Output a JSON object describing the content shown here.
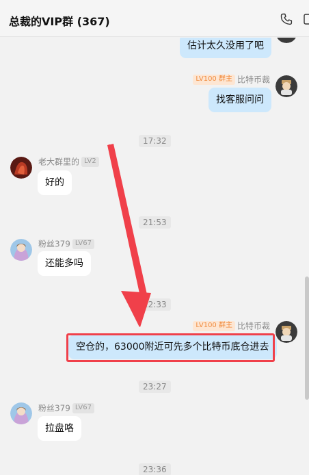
{
  "header": {
    "title": "总裁的VIP群 (367)",
    "icons": [
      "phone-icon",
      "window-icon"
    ]
  },
  "messages": [
    {
      "type": "out",
      "text": "估计太久没用了吧"
    },
    {
      "type": "out",
      "sender": "比特币裁",
      "badge": "LV100 群主",
      "text": "找客服问问"
    },
    {
      "type": "time",
      "text": "17:32"
    },
    {
      "type": "in",
      "sender": "老大群里的",
      "badge": "LV2",
      "text": "好的"
    },
    {
      "type": "time",
      "text": "21:53"
    },
    {
      "type": "in",
      "sender": "粉丝379",
      "badge": "LV67",
      "text": "还能多吗"
    },
    {
      "type": "time",
      "text": "22:33"
    },
    {
      "type": "out",
      "sender": "比特币裁",
      "badge": "LV100 群主",
      "text": "空仓的，63000附近可先多个比特币底仓进去"
    },
    {
      "type": "time",
      "text": "23:27"
    },
    {
      "type": "in",
      "sender": "粉丝379",
      "badge": "LV67",
      "text": "拉盘咯"
    },
    {
      "type": "time",
      "text": "23:36"
    }
  ],
  "annotation": {
    "color": "#f0404a"
  }
}
